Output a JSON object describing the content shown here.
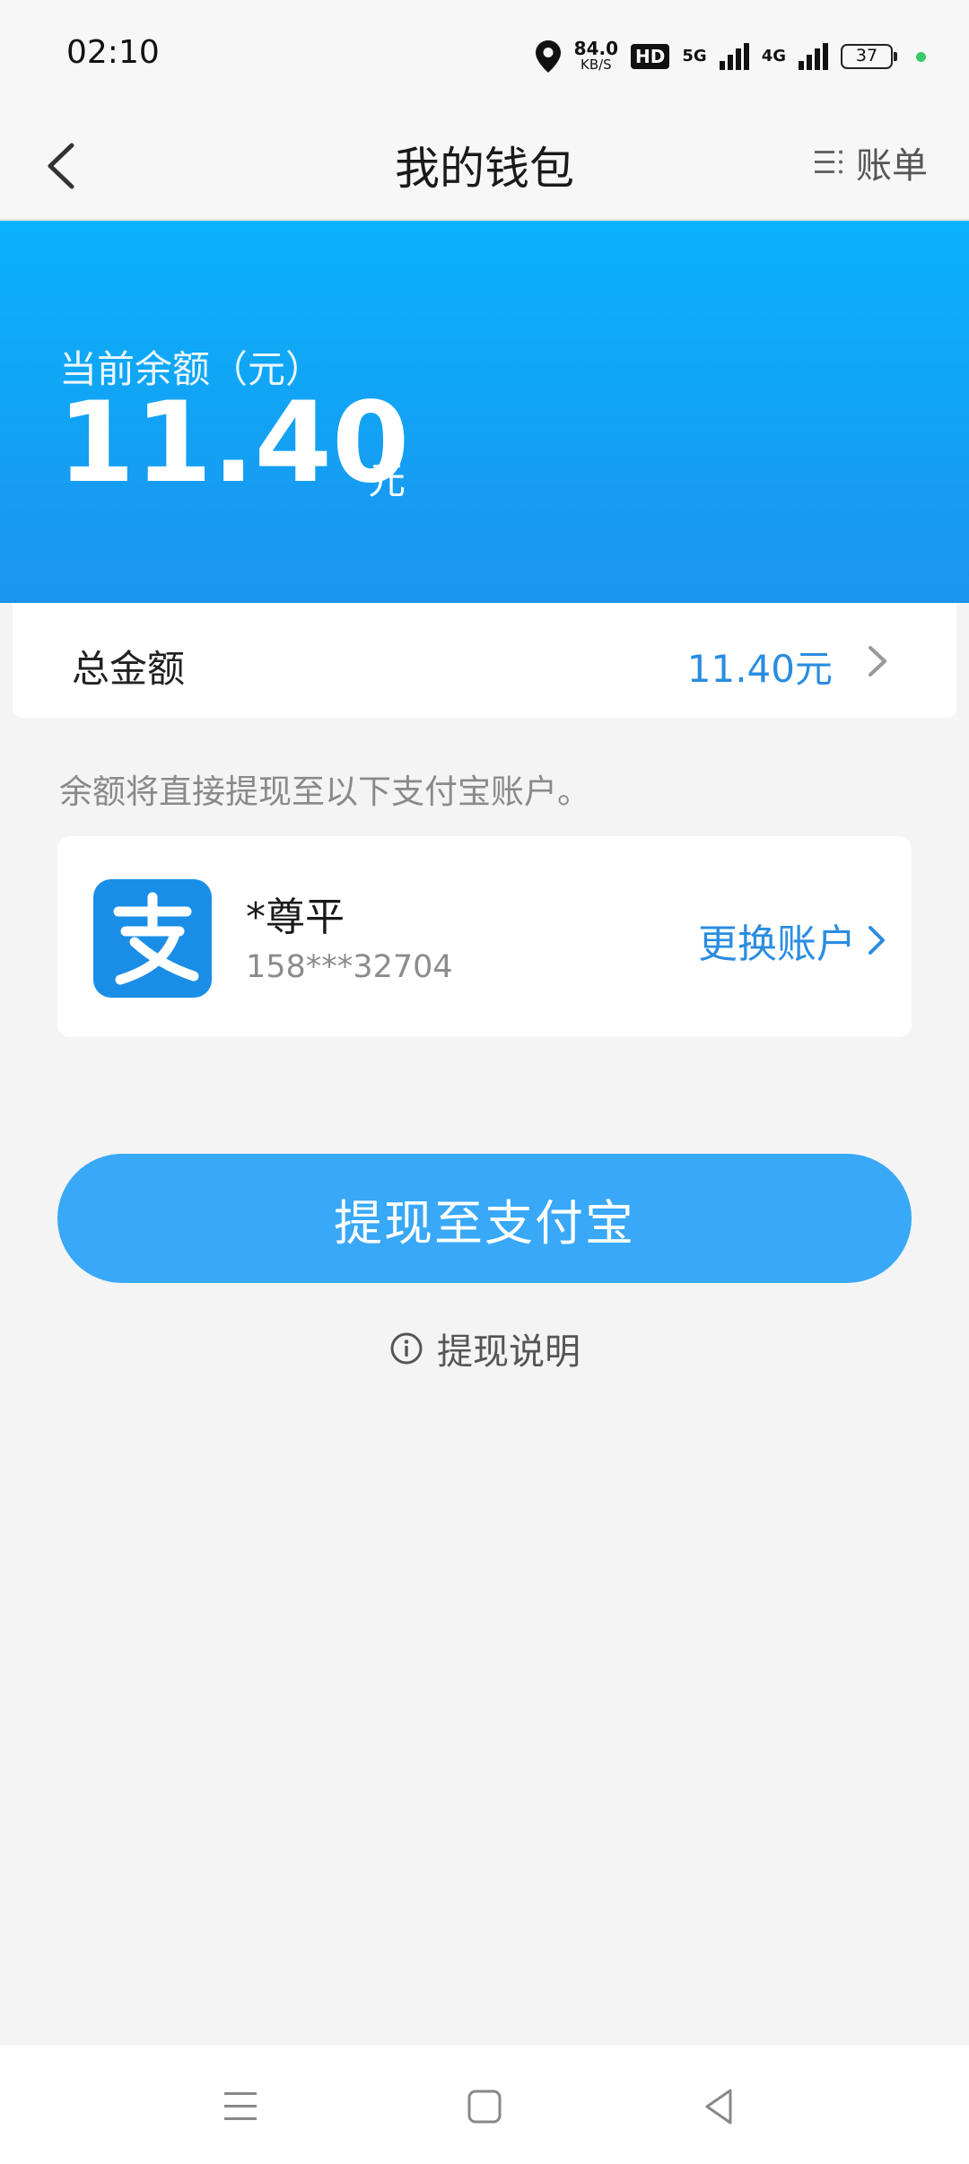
{
  "status_bar": {
    "time": "02:10",
    "net_speed": "84.0",
    "net_unit": "KB/S",
    "hd_label": "HD",
    "gen1": "5G",
    "gen2": "4G",
    "battery": "37",
    "icons": [
      "location-icon",
      "signal-icon",
      "battery-icon"
    ]
  },
  "header": {
    "title": "我的钱包",
    "bill_label": "账单",
    "back_icon": "chevron-left-icon",
    "bill_icon": "list-icon"
  },
  "balance": {
    "label": "当前余额（元）",
    "amount": "11.40",
    "unit": "元"
  },
  "total": {
    "label": "总金额",
    "value": "11.40元"
  },
  "hint": "余额将直接提现至以下支付宝账户。",
  "account": {
    "name": "*尊平",
    "phone": "158***32704",
    "change_label": "更换账户",
    "logo_char": "支"
  },
  "withdraw_button": "提现至支付宝",
  "explain_label": "提现说明",
  "colors": {
    "banner": "#09b2fb",
    "accent": "#2a8de0",
    "button": "#39a8f7",
    "alipay": "#1a8ee6"
  }
}
